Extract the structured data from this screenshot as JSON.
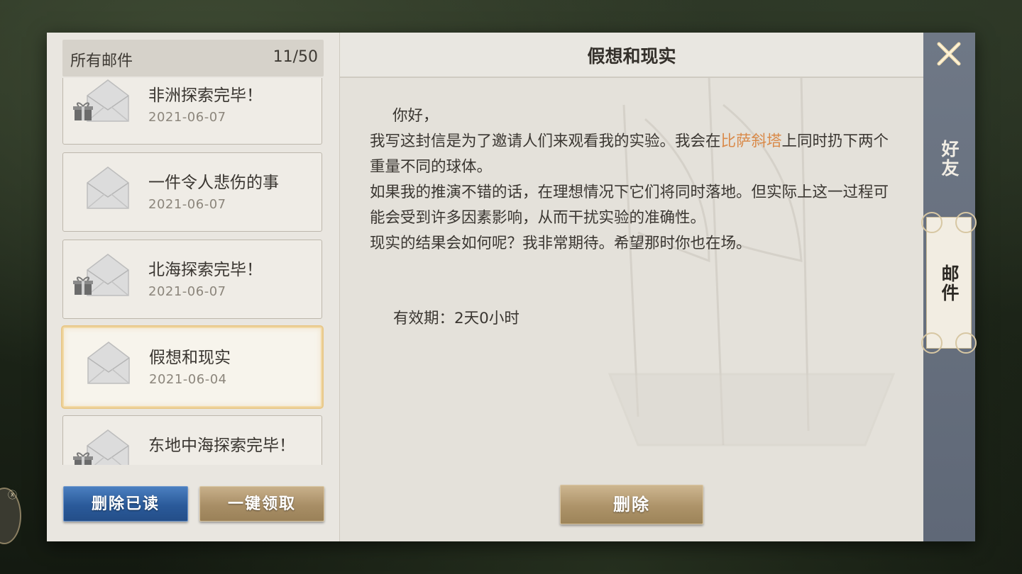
{
  "mail_list": {
    "title": "所有邮件",
    "count": "11/50",
    "items": [
      {
        "title": "非洲探索完毕！",
        "date": "2021-06-07",
        "has_gift": true,
        "selected": false
      },
      {
        "title": "一件令人悲伤的事",
        "date": "2021-06-07",
        "has_gift": false,
        "selected": false
      },
      {
        "title": "北海探索完毕！",
        "date": "2021-06-07",
        "has_gift": true,
        "selected": false
      },
      {
        "title": "假想和现实",
        "date": "2021-06-04",
        "has_gift": false,
        "selected": true
      },
      {
        "title": "东地中海探索完毕！",
        "date": "",
        "has_gift": true,
        "selected": false
      }
    ],
    "delete_read_label": "删除已读",
    "claim_all_label": "一键领取"
  },
  "detail": {
    "title": "假想和现实",
    "greeting": "你好，",
    "line1_before": "我写这封信是为了邀请人们来观看我的实验。我会在",
    "line1_highlight": "比萨斜塔",
    "line1_after": "上同时扔下两个重量不同的球体。",
    "line2": "如果我的推演不错的话，在理想情况下它们将同时落地。但实际上这一过程可能会受到许多因素影响，从而干扰实验的准确性。",
    "line3": "现实的结果会如何呢？我非常期待。希望那时你也在场。",
    "validity": "有效期：2天0小时",
    "delete_label": "删除"
  },
  "tabs": {
    "friends_label": "好友",
    "mail_label": "邮件",
    "close_icon": "close-x-icon"
  },
  "colors": {
    "highlight": "#d98a4a",
    "tab_bar": "#6f7886",
    "btn_blue": "#2a5a9a",
    "btn_gold": "#a88e66"
  }
}
